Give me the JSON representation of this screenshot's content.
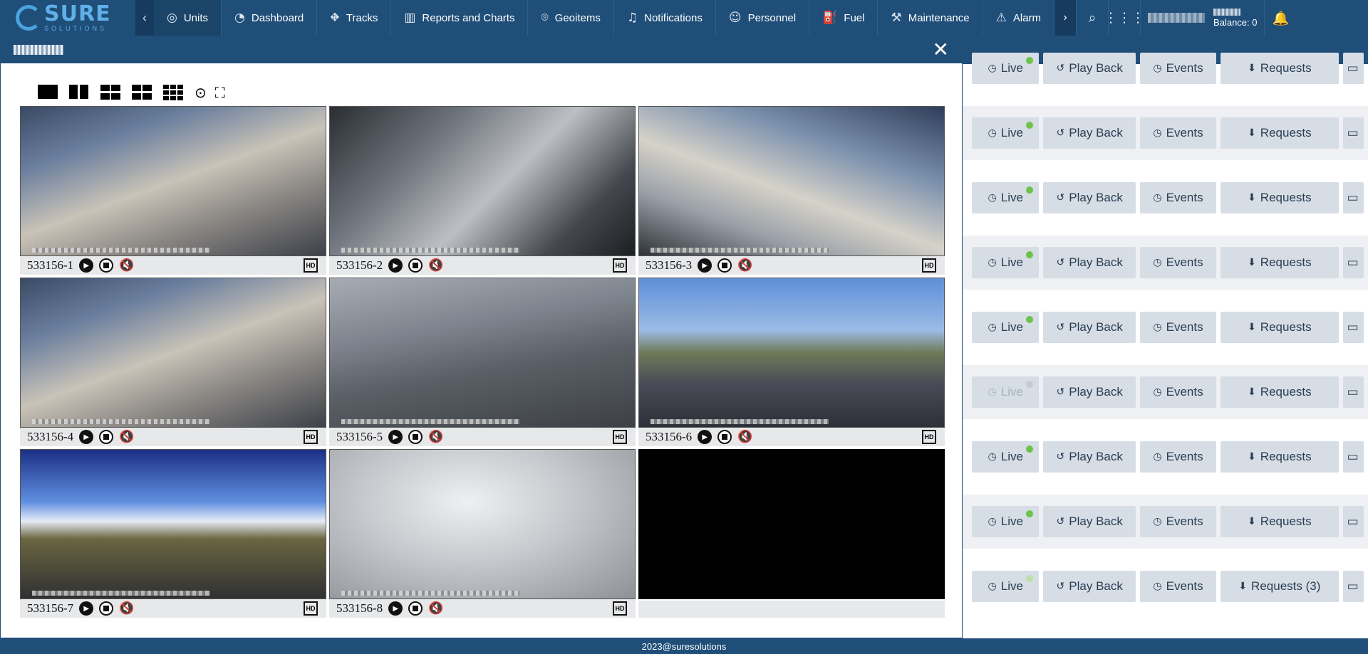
{
  "nav": {
    "brand": "SURE",
    "brand_sub": "SOLUTIONS",
    "items": [
      {
        "label": "Units",
        "icon": "units-icon"
      },
      {
        "label": "Dashboard",
        "icon": "dashboard-icon"
      },
      {
        "label": "Tracks",
        "icon": "tracks-icon"
      },
      {
        "label": "Reports and Charts",
        "icon": "chart-icon"
      },
      {
        "label": "Geoitems",
        "icon": "location-pin-icon"
      },
      {
        "label": "Notifications",
        "icon": "bell-icon"
      },
      {
        "label": "Personnel",
        "icon": "person-icon"
      },
      {
        "label": "Fuel",
        "icon": "fuel-icon"
      },
      {
        "label": "Maintenance",
        "icon": "wrench-icon"
      },
      {
        "label": "Alarm",
        "icon": "alarm-icon"
      }
    ],
    "balance": "Balance: 0"
  },
  "modal": {
    "cameras": [
      {
        "name": "533156-1",
        "feed": "bus"
      },
      {
        "name": "533156-2",
        "feed": "driver"
      },
      {
        "name": "533156-3",
        "feed": "bus2"
      },
      {
        "name": "533156-4",
        "feed": "bus"
      },
      {
        "name": "533156-5",
        "feed": "road1"
      },
      {
        "name": "533156-6",
        "feed": "road2"
      },
      {
        "name": "533156-7",
        "feed": "sunset"
      },
      {
        "name": "533156-8",
        "feed": "fog"
      }
    ]
  },
  "actions": {
    "live": "Live",
    "playback": "Play Back",
    "events": "Events",
    "requests": "Requests",
    "requests_last": "Requests (3)"
  },
  "rows": [
    {
      "status": "online"
    },
    {
      "status": "online"
    },
    {
      "status": "online"
    },
    {
      "status": "online"
    },
    {
      "status": "online"
    },
    {
      "status": "offline"
    },
    {
      "status": "online"
    },
    {
      "status": "online"
    },
    {
      "status": "faint"
    }
  ],
  "footer": "2023@suresolutions"
}
